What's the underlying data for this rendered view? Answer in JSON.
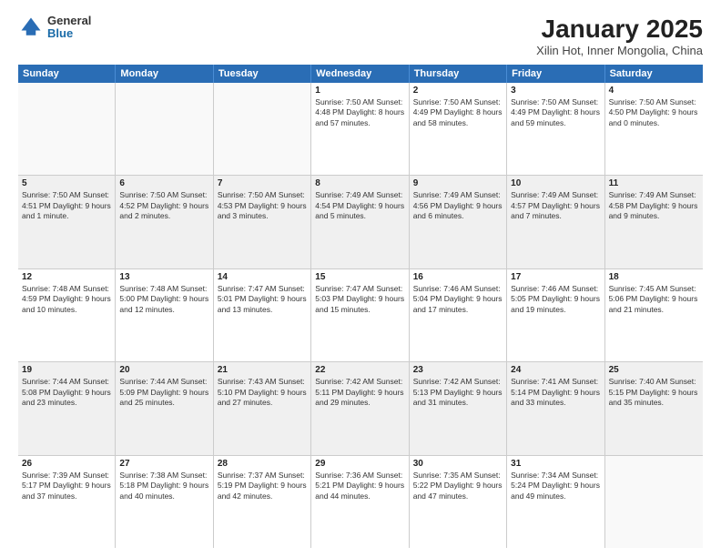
{
  "logo": {
    "general": "General",
    "blue": "Blue"
  },
  "title": "January 2025",
  "subtitle": "Xilin Hot, Inner Mongolia, China",
  "header_days": [
    "Sunday",
    "Monday",
    "Tuesday",
    "Wednesday",
    "Thursday",
    "Friday",
    "Saturday"
  ],
  "rows": [
    [
      {
        "day": "",
        "text": "",
        "empty": true
      },
      {
        "day": "",
        "text": "",
        "empty": true
      },
      {
        "day": "",
        "text": "",
        "empty": true
      },
      {
        "day": "1",
        "text": "Sunrise: 7:50 AM\nSunset: 4:48 PM\nDaylight: 8 hours\nand 57 minutes.",
        "empty": false
      },
      {
        "day": "2",
        "text": "Sunrise: 7:50 AM\nSunset: 4:49 PM\nDaylight: 8 hours\nand 58 minutes.",
        "empty": false
      },
      {
        "day": "3",
        "text": "Sunrise: 7:50 AM\nSunset: 4:49 PM\nDaylight: 8 hours\nand 59 minutes.",
        "empty": false
      },
      {
        "day": "4",
        "text": "Sunrise: 7:50 AM\nSunset: 4:50 PM\nDaylight: 9 hours\nand 0 minutes.",
        "empty": false
      }
    ],
    [
      {
        "day": "5",
        "text": "Sunrise: 7:50 AM\nSunset: 4:51 PM\nDaylight: 9 hours\nand 1 minute.",
        "empty": false
      },
      {
        "day": "6",
        "text": "Sunrise: 7:50 AM\nSunset: 4:52 PM\nDaylight: 9 hours\nand 2 minutes.",
        "empty": false
      },
      {
        "day": "7",
        "text": "Sunrise: 7:50 AM\nSunset: 4:53 PM\nDaylight: 9 hours\nand 3 minutes.",
        "empty": false
      },
      {
        "day": "8",
        "text": "Sunrise: 7:49 AM\nSunset: 4:54 PM\nDaylight: 9 hours\nand 5 minutes.",
        "empty": false
      },
      {
        "day": "9",
        "text": "Sunrise: 7:49 AM\nSunset: 4:56 PM\nDaylight: 9 hours\nand 6 minutes.",
        "empty": false
      },
      {
        "day": "10",
        "text": "Sunrise: 7:49 AM\nSunset: 4:57 PM\nDaylight: 9 hours\nand 7 minutes.",
        "empty": false
      },
      {
        "day": "11",
        "text": "Sunrise: 7:49 AM\nSunset: 4:58 PM\nDaylight: 9 hours\nand 9 minutes.",
        "empty": false
      }
    ],
    [
      {
        "day": "12",
        "text": "Sunrise: 7:48 AM\nSunset: 4:59 PM\nDaylight: 9 hours\nand 10 minutes.",
        "empty": false
      },
      {
        "day": "13",
        "text": "Sunrise: 7:48 AM\nSunset: 5:00 PM\nDaylight: 9 hours\nand 12 minutes.",
        "empty": false
      },
      {
        "day": "14",
        "text": "Sunrise: 7:47 AM\nSunset: 5:01 PM\nDaylight: 9 hours\nand 13 minutes.",
        "empty": false
      },
      {
        "day": "15",
        "text": "Sunrise: 7:47 AM\nSunset: 5:03 PM\nDaylight: 9 hours\nand 15 minutes.",
        "empty": false
      },
      {
        "day": "16",
        "text": "Sunrise: 7:46 AM\nSunset: 5:04 PM\nDaylight: 9 hours\nand 17 minutes.",
        "empty": false
      },
      {
        "day": "17",
        "text": "Sunrise: 7:46 AM\nSunset: 5:05 PM\nDaylight: 9 hours\nand 19 minutes.",
        "empty": false
      },
      {
        "day": "18",
        "text": "Sunrise: 7:45 AM\nSunset: 5:06 PM\nDaylight: 9 hours\nand 21 minutes.",
        "empty": false
      }
    ],
    [
      {
        "day": "19",
        "text": "Sunrise: 7:44 AM\nSunset: 5:08 PM\nDaylight: 9 hours\nand 23 minutes.",
        "empty": false
      },
      {
        "day": "20",
        "text": "Sunrise: 7:44 AM\nSunset: 5:09 PM\nDaylight: 9 hours\nand 25 minutes.",
        "empty": false
      },
      {
        "day": "21",
        "text": "Sunrise: 7:43 AM\nSunset: 5:10 PM\nDaylight: 9 hours\nand 27 minutes.",
        "empty": false
      },
      {
        "day": "22",
        "text": "Sunrise: 7:42 AM\nSunset: 5:11 PM\nDaylight: 9 hours\nand 29 minutes.",
        "empty": false
      },
      {
        "day": "23",
        "text": "Sunrise: 7:42 AM\nSunset: 5:13 PM\nDaylight: 9 hours\nand 31 minutes.",
        "empty": false
      },
      {
        "day": "24",
        "text": "Sunrise: 7:41 AM\nSunset: 5:14 PM\nDaylight: 9 hours\nand 33 minutes.",
        "empty": false
      },
      {
        "day": "25",
        "text": "Sunrise: 7:40 AM\nSunset: 5:15 PM\nDaylight: 9 hours\nand 35 minutes.",
        "empty": false
      }
    ],
    [
      {
        "day": "26",
        "text": "Sunrise: 7:39 AM\nSunset: 5:17 PM\nDaylight: 9 hours\nand 37 minutes.",
        "empty": false
      },
      {
        "day": "27",
        "text": "Sunrise: 7:38 AM\nSunset: 5:18 PM\nDaylight: 9 hours\nand 40 minutes.",
        "empty": false
      },
      {
        "day": "28",
        "text": "Sunrise: 7:37 AM\nSunset: 5:19 PM\nDaylight: 9 hours\nand 42 minutes.",
        "empty": false
      },
      {
        "day": "29",
        "text": "Sunrise: 7:36 AM\nSunset: 5:21 PM\nDaylight: 9 hours\nand 44 minutes.",
        "empty": false
      },
      {
        "day": "30",
        "text": "Sunrise: 7:35 AM\nSunset: 5:22 PM\nDaylight: 9 hours\nand 47 minutes.",
        "empty": false
      },
      {
        "day": "31",
        "text": "Sunrise: 7:34 AM\nSunset: 5:24 PM\nDaylight: 9 hours\nand 49 minutes.",
        "empty": false
      },
      {
        "day": "",
        "text": "",
        "empty": true
      }
    ]
  ]
}
